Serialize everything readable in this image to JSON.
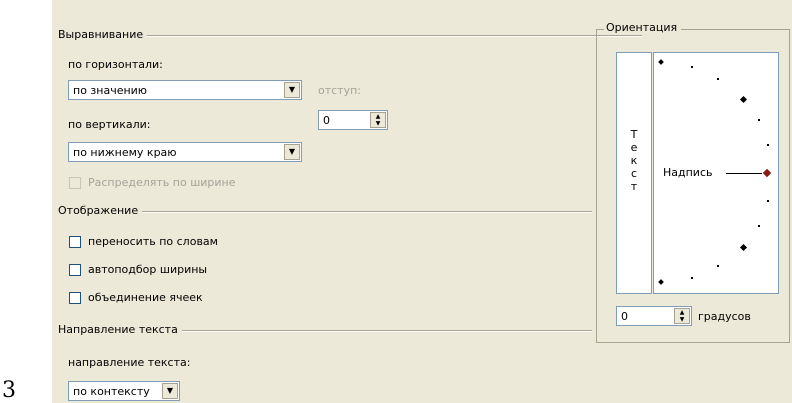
{
  "outer_label": "3",
  "alignment": {
    "title": "Выравнивание",
    "horizontal_label": "по горизонтали:",
    "horizontal_value": "по значению",
    "indent_label": "отступ:",
    "indent_value": "0",
    "vertical_label": "по вертикали:",
    "vertical_value": "по нижнему краю",
    "distribute_label": "Распределять по ширине"
  },
  "display": {
    "title": "Отображение",
    "wrap_label": "переносить по словам",
    "autofit_label": "автоподбор ширины",
    "merge_label": "объединение ячеек"
  },
  "direction": {
    "title": "Направление текста",
    "label": "направление текста:",
    "value": "по контексту"
  },
  "orientation": {
    "title": "Ориентация",
    "vertical_text_chars": [
      "Т",
      "е",
      "к",
      "с",
      "т"
    ],
    "inscription": "Надпись",
    "degrees_value": "0",
    "degrees_label": "градусов",
    "marker_color": "#8b1a1a"
  },
  "icons": {
    "dropdown": "chevron-down-icon",
    "spinner": "spinner-arrows-icon"
  }
}
